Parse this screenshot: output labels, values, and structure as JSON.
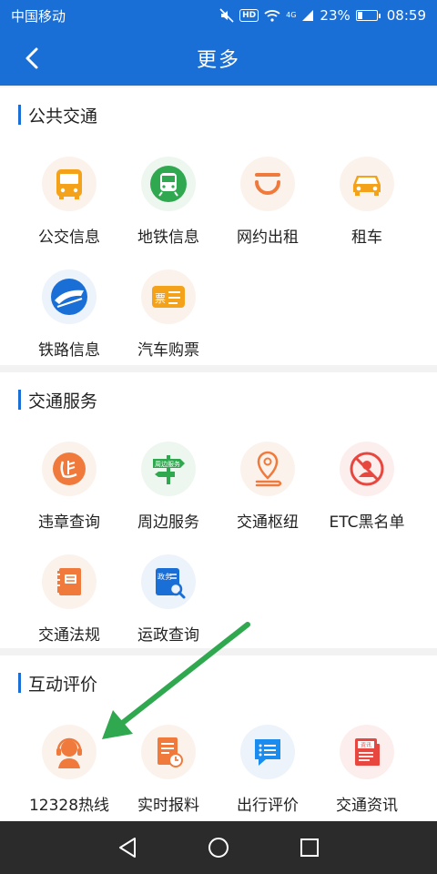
{
  "status": {
    "carrier": "中国移动",
    "network": "4G",
    "battery": "23%",
    "battery_level": 0.23,
    "time": "08:59",
    "hd": "HD"
  },
  "appbar": {
    "title": "更多"
  },
  "sections": [
    {
      "title": "公共交通",
      "items": [
        {
          "label": "公交信息",
          "icon": "bus-icon"
        },
        {
          "label": "地铁信息",
          "icon": "subway-icon"
        },
        {
          "label": "网约出租",
          "icon": "ride-hailing-icon"
        },
        {
          "label": "租车",
          "icon": "car-rental-icon"
        },
        {
          "label": "铁路信息",
          "icon": "railway-icon"
        },
        {
          "label": "汽车购票",
          "icon": "ticket-icon",
          "icon_text": "票"
        }
      ]
    },
    {
      "title": "交通服务",
      "items": [
        {
          "label": "违章查询",
          "icon": "violation-icon"
        },
        {
          "label": "周边服务",
          "icon": "signpost-icon",
          "icon_text": "周边服务"
        },
        {
          "label": "交通枢纽",
          "icon": "location-pin-icon"
        },
        {
          "label": "ETC黑名单",
          "icon": "blacklist-icon"
        },
        {
          "label": "交通法规",
          "icon": "law-book-icon"
        },
        {
          "label": "运政查询",
          "icon": "gov-search-icon",
          "icon_text": "政务"
        }
      ]
    },
    {
      "title": "互动评价",
      "items": [
        {
          "label": "12328热线",
          "icon": "hotline-icon"
        },
        {
          "label": "实时报料",
          "icon": "report-icon"
        },
        {
          "label": "出行评价",
          "icon": "comment-icon"
        },
        {
          "label": "交通资讯",
          "icon": "news-icon",
          "icon_text": "资讯"
        }
      ]
    }
  ],
  "colors": {
    "primary": "#1a6fd6",
    "orange": "#f07a3c",
    "green": "#2fa84f",
    "arrow": "#2fa84f"
  }
}
